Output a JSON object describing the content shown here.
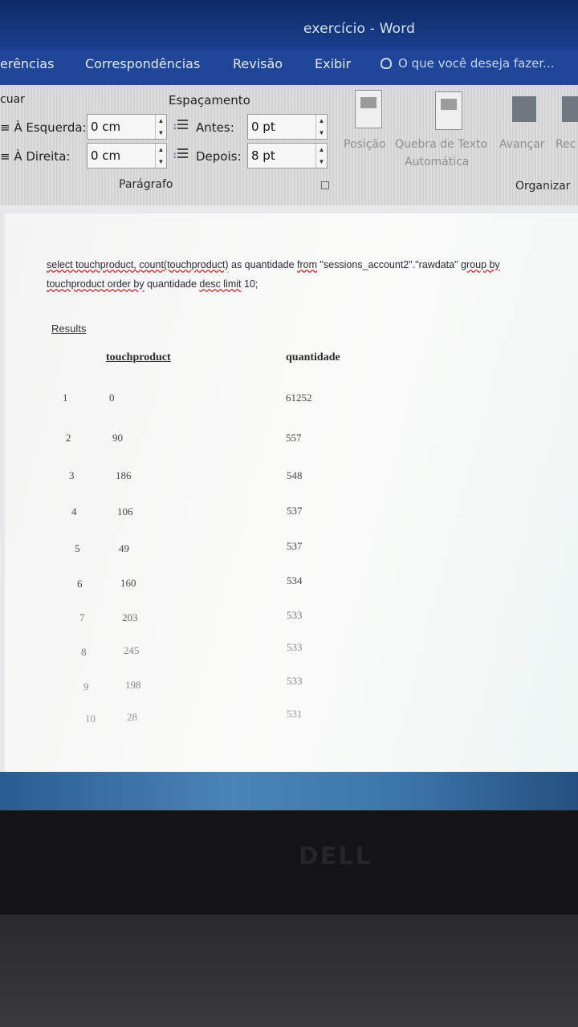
{
  "window": {
    "title": "exercício - Word"
  },
  "tabs": [
    "erências",
    "Correspondências",
    "Revisão",
    "Exibir"
  ],
  "tell_me": "O que você deseja fazer...",
  "ribbon": {
    "indent_group_partial": "cuar",
    "spacing_group": "Espaçamento",
    "left_label": "À Esquerda:",
    "left_value": "0 cm",
    "right_label": "À Direita:",
    "right_value": "0 cm",
    "before_label": "Antes:",
    "before_value": "0 pt",
    "after_label": "Depois:",
    "after_value": "8 pt",
    "paragraph_group": "Parágrafo",
    "position_label": "Posição",
    "wrap_label": "Quebra de Texto",
    "wrap_label2": "Automática",
    "forward_label": "Avançar",
    "recede_partial": "Rec",
    "arrange_group": "Organizar"
  },
  "document": {
    "query_line1_a": "select touchproduct, count(touchproduct)",
    "query_line1_b": " as quantidade ",
    "query_line1_c": "from",
    "query_line1_d": " \"sessions_account2\".\"rawdata\" ",
    "query_line1_e": "group by",
    "query_line2_a": "touchproduct order by",
    "query_line2_b": " quantidade ",
    "query_line2_c": "desc limit",
    "query_line2_d": " 10;",
    "results_label": "Results",
    "headers": [
      "touchproduct",
      "quantidade"
    ],
    "rows": [
      {
        "n": "1",
        "product": "0",
        "qty": "61252"
      },
      {
        "n": "2",
        "product": "90",
        "qty": "557"
      },
      {
        "n": "3",
        "product": "186",
        "qty": "548"
      },
      {
        "n": "4",
        "product": "106",
        "qty": "537"
      },
      {
        "n": "5",
        "product": "49",
        "qty": "537"
      },
      {
        "n": "6",
        "product": "160",
        "qty": "534"
      },
      {
        "n": "7",
        "product": "203",
        "qty": "533"
      },
      {
        "n": "8",
        "product": "245",
        "qty": "533"
      },
      {
        "n": "9",
        "product": "198",
        "qty": "533"
      },
      {
        "n": "10",
        "product": "28",
        "qty": "531"
      }
    ]
  },
  "hardware": {
    "logo": "DELL"
  }
}
